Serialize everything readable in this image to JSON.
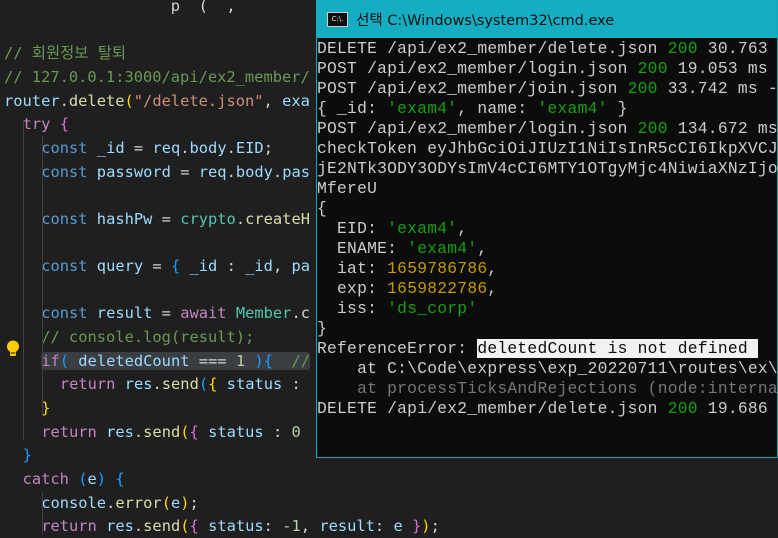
{
  "editor": {
    "lines": [
      {
        "indent": 0,
        "tokens": [
          [
            "                  p  (  ,   ",
            "p"
          ]
        ]
      },
      {
        "indent": 0,
        "tokens": []
      },
      {
        "indent": 0,
        "tokens": [
          [
            "// 회원정보 탈퇴",
            "c"
          ]
        ]
      },
      {
        "indent": 0,
        "tokens": [
          [
            "// 127.0.0.1:3000/api/ex2_member/",
            "c"
          ]
        ]
      },
      {
        "indent": 0,
        "tokens": [
          [
            "router",
            "v"
          ],
          [
            ".",
            "p"
          ],
          [
            "delete",
            "f"
          ],
          [
            "(",
            "b1"
          ],
          [
            "\"/delete.json\"",
            "st"
          ],
          [
            ", ",
            "p"
          ],
          [
            "exa",
            "v"
          ]
        ]
      },
      {
        "indent": 1,
        "tokens": [
          [
            "try",
            "k"
          ],
          [
            " ",
            "p"
          ],
          [
            "{",
            "b2"
          ]
        ]
      },
      {
        "indent": 2,
        "tokens": [
          [
            "const",
            "s"
          ],
          [
            " _id ",
            "v"
          ],
          [
            "= ",
            "p"
          ],
          [
            "req",
            "v"
          ],
          [
            ".",
            "p"
          ],
          [
            "body",
            "v"
          ],
          [
            ".",
            "p"
          ],
          [
            "EID",
            "v"
          ],
          [
            ";",
            "p"
          ]
        ]
      },
      {
        "indent": 2,
        "tokens": [
          [
            "const",
            "s"
          ],
          [
            " password ",
            "v"
          ],
          [
            "= ",
            "p"
          ],
          [
            "req",
            "v"
          ],
          [
            ".",
            "p"
          ],
          [
            "body",
            "v"
          ],
          [
            ".",
            "p"
          ],
          [
            "pas",
            "v"
          ]
        ]
      },
      {
        "indent": 0,
        "tokens": []
      },
      {
        "indent": 2,
        "tokens": [
          [
            "const",
            "s"
          ],
          [
            " hashPw ",
            "v"
          ],
          [
            "= ",
            "p"
          ],
          [
            "crypto",
            "t"
          ],
          [
            ".",
            "p"
          ],
          [
            "createH",
            "f"
          ]
        ]
      },
      {
        "indent": 0,
        "tokens": []
      },
      {
        "indent": 2,
        "tokens": [
          [
            "const",
            "s"
          ],
          [
            " query ",
            "v"
          ],
          [
            "= ",
            "p"
          ],
          [
            "{",
            "b3"
          ],
          [
            " _id ",
            "v"
          ],
          [
            ": ",
            "p"
          ],
          [
            "_id",
            "v"
          ],
          [
            ", ",
            "p"
          ],
          [
            "pa",
            "v"
          ]
        ]
      },
      {
        "indent": 0,
        "tokens": []
      },
      {
        "indent": 2,
        "tokens": [
          [
            "const",
            "s"
          ],
          [
            " result ",
            "v"
          ],
          [
            "= ",
            "p"
          ],
          [
            "await",
            "k"
          ],
          [
            " ",
            "p"
          ],
          [
            "Member",
            "t"
          ],
          [
            ".c",
            "p"
          ]
        ]
      },
      {
        "indent": 2,
        "tokens": [
          [
            "// console.log(result);",
            "c"
          ]
        ]
      },
      {
        "indent": 2,
        "hl": true,
        "tokens": [
          [
            "if",
            "k"
          ],
          [
            "(",
            "b3"
          ],
          [
            " deletedCount ",
            "v"
          ],
          [
            "=== ",
            "p"
          ],
          [
            "1",
            "n"
          ],
          [
            " )",
            "b3"
          ],
          [
            "{",
            "b3"
          ],
          [
            "  //",
            "c"
          ]
        ]
      },
      {
        "indent": 3,
        "tokens": [
          [
            "return",
            "k"
          ],
          [
            " res",
            "v"
          ],
          [
            ".",
            "p"
          ],
          [
            "send",
            "f"
          ],
          [
            "(",
            "b3"
          ],
          [
            "{",
            "b1"
          ],
          [
            " status ",
            "v"
          ],
          [
            ":",
            "p"
          ]
        ]
      },
      {
        "indent": 2,
        "tokens": [
          [
            "}",
            "b1"
          ]
        ]
      },
      {
        "indent": 2,
        "tokens": [
          [
            "return",
            "k"
          ],
          [
            " res",
            "v"
          ],
          [
            ".",
            "p"
          ],
          [
            "send",
            "f"
          ],
          [
            "(",
            "b1"
          ],
          [
            "{",
            "b2"
          ],
          [
            " status ",
            "v"
          ],
          [
            ": ",
            "p"
          ],
          [
            "0",
            "n"
          ]
        ]
      },
      {
        "indent": 1,
        "tokens": [
          [
            "}",
            "b3"
          ]
        ]
      },
      {
        "indent": 1,
        "tokens": [
          [
            "catch",
            "k"
          ],
          [
            " ",
            "p"
          ],
          [
            "(",
            "b3"
          ],
          [
            "e",
            "v"
          ],
          [
            ")",
            "b3"
          ],
          [
            " ",
            "p"
          ],
          [
            "{",
            "b3"
          ]
        ]
      },
      {
        "indent": 2,
        "tokens": [
          [
            "console",
            "v"
          ],
          [
            ".",
            "p"
          ],
          [
            "error",
            "f"
          ],
          [
            "(",
            "b1"
          ],
          [
            "e",
            "v"
          ],
          [
            ")",
            "b1"
          ],
          [
            ";",
            "p"
          ]
        ]
      },
      {
        "indent": 2,
        "tokens": [
          [
            "return",
            "k"
          ],
          [
            " res",
            "v"
          ],
          [
            ".",
            "p"
          ],
          [
            "send",
            "f"
          ],
          [
            "(",
            "b1"
          ],
          [
            "{",
            "b2"
          ],
          [
            " status",
            "v"
          ],
          [
            ": ",
            "p"
          ],
          [
            "-1",
            "n"
          ],
          [
            ", ",
            "p"
          ],
          [
            "result",
            "v"
          ],
          [
            ": ",
            "p"
          ],
          [
            "e",
            "v"
          ],
          [
            " }",
            "b2"
          ],
          [
            ")",
            "b1"
          ],
          [
            ";",
            "p"
          ]
        ]
      }
    ]
  },
  "terminal": {
    "title": "선택 C:\\Windows\\system32\\cmd.exe",
    "icon_label": "C:\\.",
    "lines": [
      [
        [
          "DELETE /api/ex2_member/delete.json ",
          ""
        ],
        [
          "200",
          "g"
        ],
        [
          " 30.763",
          ""
        ]
      ],
      [
        [
          "POST /api/ex2_member/login.json ",
          ""
        ],
        [
          "200",
          "g"
        ],
        [
          " 19.053 ms",
          ""
        ]
      ],
      [
        [
          "POST /api/ex2_member/join.json ",
          ""
        ],
        [
          "200",
          "g"
        ],
        [
          " 33.742 ms -",
          ""
        ]
      ],
      [
        [
          "{ _id: ",
          ""
        ],
        [
          "'exam4'",
          "g"
        ],
        [
          ", name: ",
          ""
        ],
        [
          "'exam4'",
          "g"
        ],
        [
          " }",
          ""
        ]
      ],
      [
        [
          "POST /api/ex2_member/login.json ",
          ""
        ],
        [
          "200",
          "g"
        ],
        [
          " 134.672 ms",
          ""
        ]
      ],
      [
        [
          "checkToken eyJhbGciOiJIUzI1NiIsInR5cCI6IkpXVCJ",
          ""
        ]
      ],
      [
        [
          "jE2NTk3ODY3ODYsImV4cCI6MTY1OTgyMjc4NiwiaXNzIjo",
          ""
        ]
      ],
      [
        [
          "MfereU",
          ""
        ]
      ],
      [
        [
          "{",
          ""
        ]
      ],
      [
        [
          "  EID: ",
          ""
        ],
        [
          "'exam4'",
          "g"
        ],
        [
          ",",
          ""
        ]
      ],
      [
        [
          "  ENAME: ",
          ""
        ],
        [
          "'exam4'",
          "g"
        ],
        [
          ",",
          ""
        ]
      ],
      [
        [
          "  iat: ",
          ""
        ],
        [
          "1659786786",
          "y"
        ],
        [
          ",",
          ""
        ]
      ],
      [
        [
          "  exp: ",
          ""
        ],
        [
          "1659822786",
          "y"
        ],
        [
          ",",
          ""
        ]
      ],
      [
        [
          "  iss: ",
          ""
        ],
        [
          "'ds_corp'",
          "g"
        ]
      ],
      [
        [
          "}",
          ""
        ]
      ],
      [
        [
          "ReferenceError: ",
          ""
        ],
        [
          "deletedCount is not defined ",
          "sel"
        ]
      ],
      [
        [
          "    at C:\\Code\\express\\exp_20220711\\routes\\ex\\",
          ""
        ]
      ],
      [
        [
          "    at processTicksAndRejections (node:interna",
          "d"
        ]
      ],
      [
        [
          "DELETE /api/ex2_member/delete.json ",
          ""
        ],
        [
          "200",
          "g"
        ],
        [
          " 19.686",
          ""
        ]
      ]
    ]
  }
}
